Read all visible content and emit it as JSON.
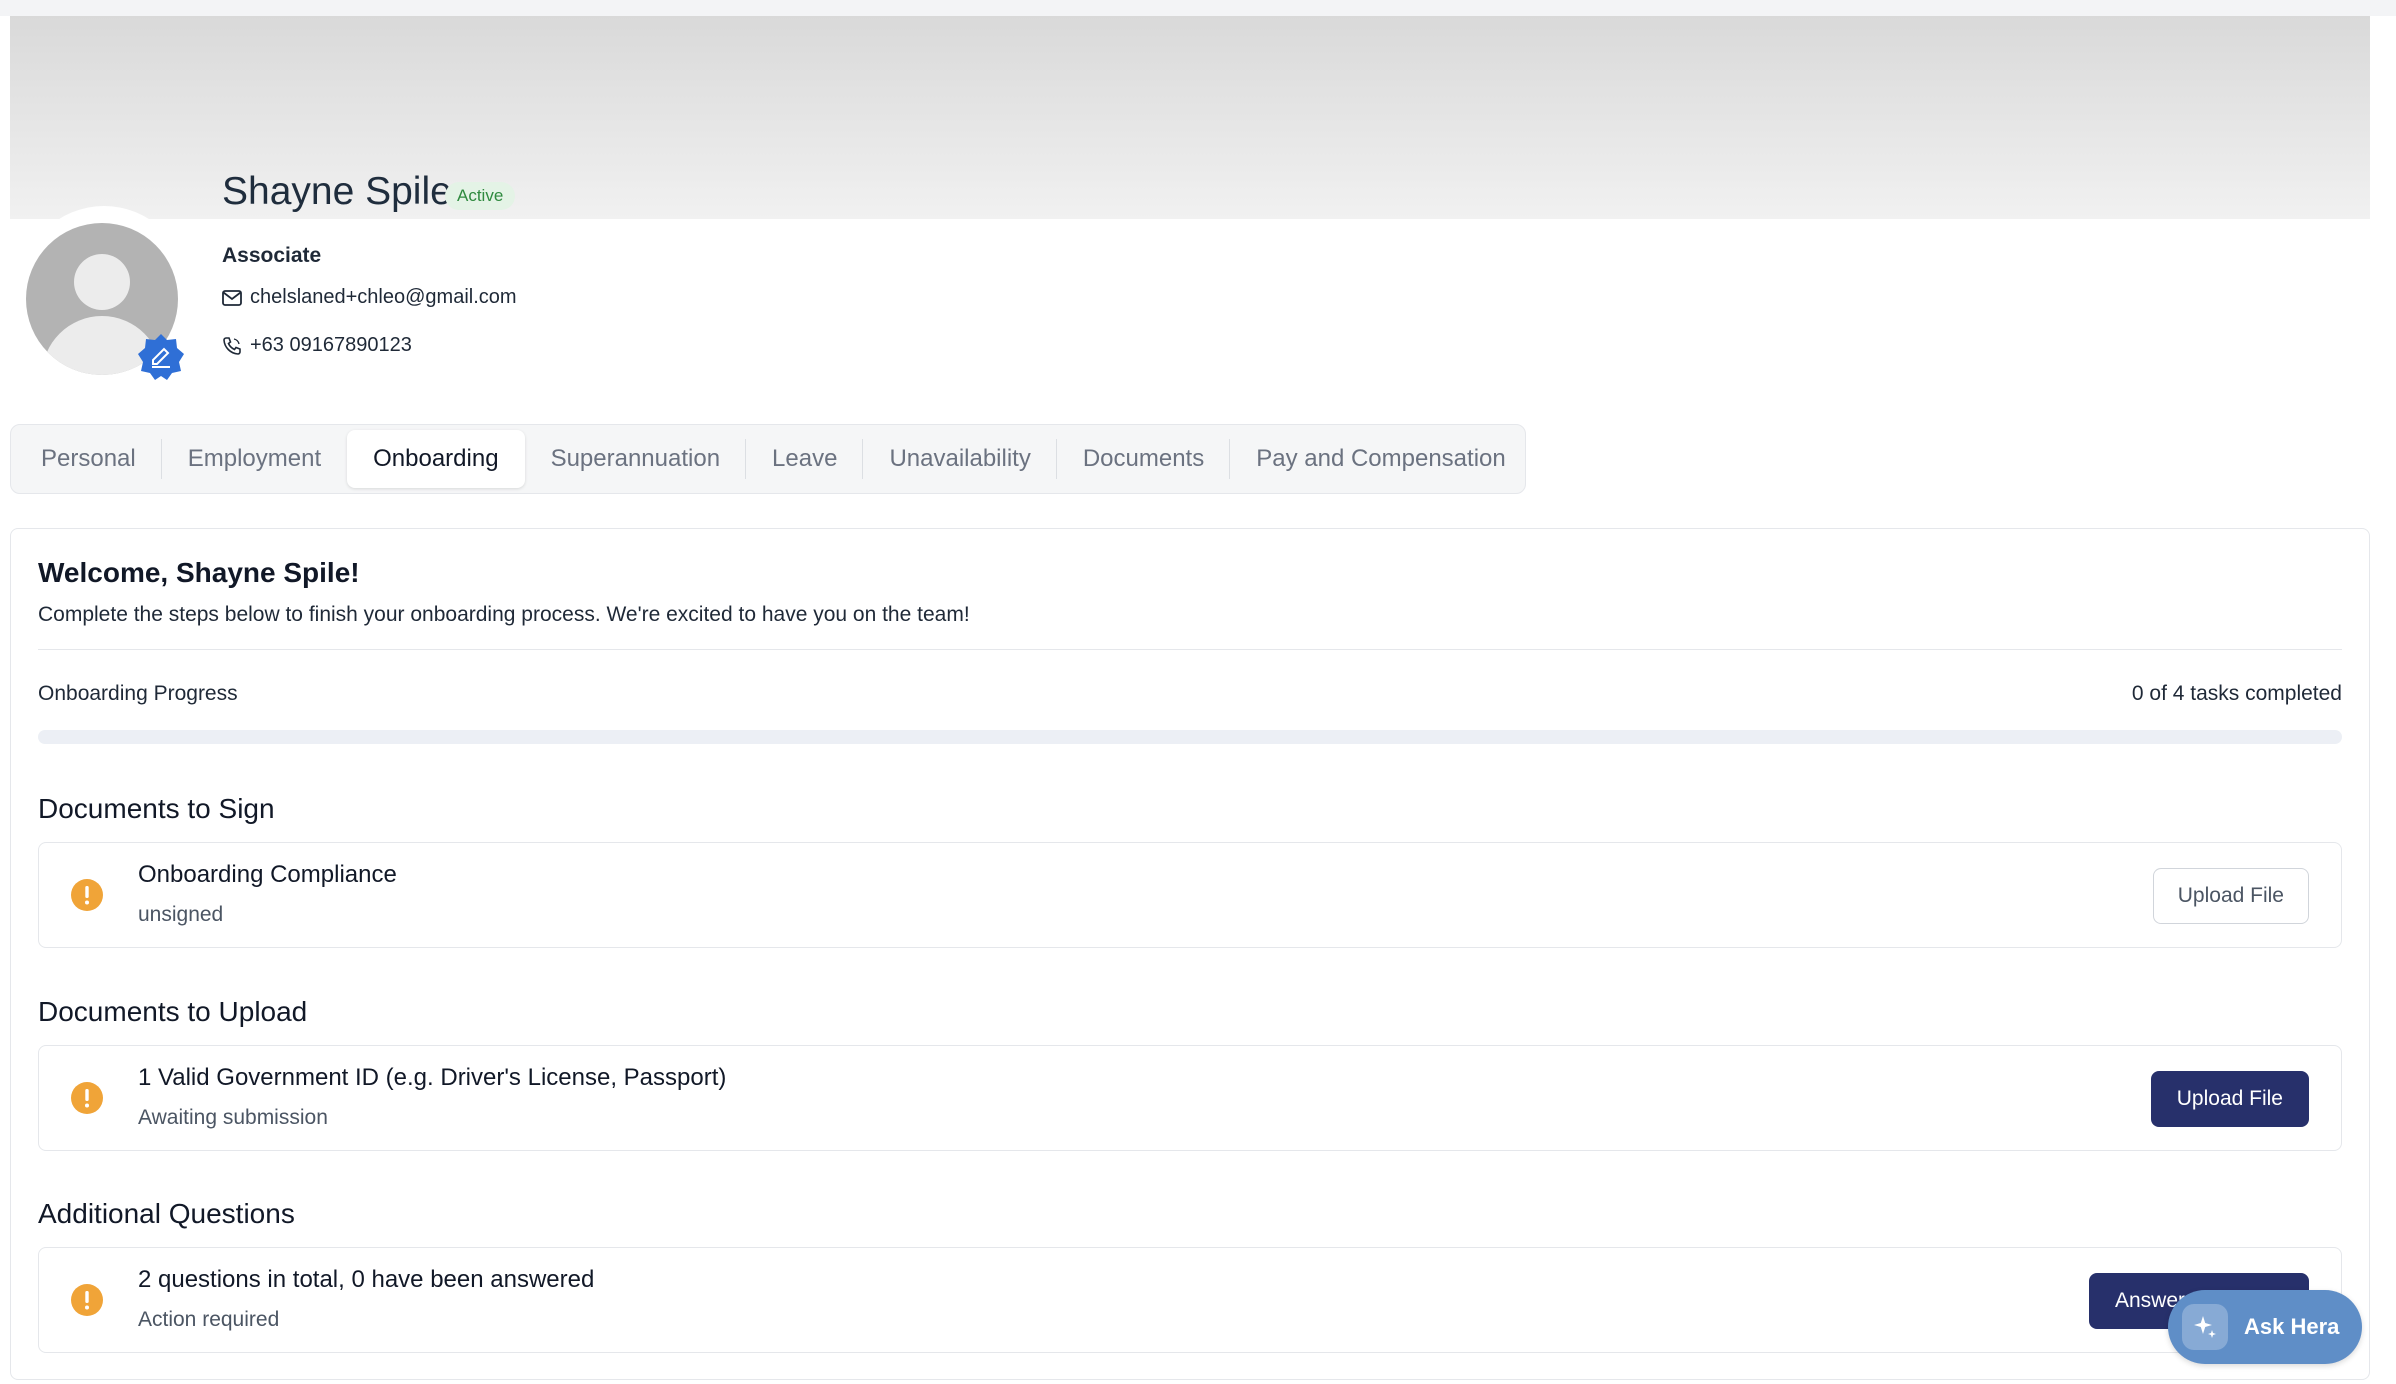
{
  "profile": {
    "name": "Shayne Spile",
    "status": "Active",
    "role": "Associate",
    "email": "chelslaned+chleo@gmail.com",
    "phone": "+63 09167890123"
  },
  "tabs": [
    {
      "label": "Personal"
    },
    {
      "label": "Employment"
    },
    {
      "label": "Onboarding",
      "active": true
    },
    {
      "label": "Superannuation"
    },
    {
      "label": "Leave"
    },
    {
      "label": "Unavailability"
    },
    {
      "label": "Documents"
    },
    {
      "label": "Pay and Compensation"
    }
  ],
  "onboarding": {
    "welcome": "Welcome, Shayne Spile!",
    "subtitle": "Complete the steps below to finish your onboarding process. We're excited to have you on the team!",
    "progress_label": "Onboarding Progress",
    "progress_count": "0 of 4 tasks completed",
    "progress_fraction": 0,
    "sections": [
      {
        "title": "Documents to Sign",
        "items": [
          {
            "title": "Onboarding Compliance",
            "status": "unsigned",
            "button": "Upload File"
          }
        ]
      },
      {
        "title": "Documents to Upload",
        "items": [
          {
            "title": "1 Valid Government ID (e.g. Driver's License, Passport)",
            "status": "Awaiting submission",
            "button": "Upload File"
          }
        ]
      },
      {
        "title": "Additional Questions",
        "items": [
          {
            "title": "2 questions in total, 0 have been answered",
            "status": "Action required",
            "button": "Answer Questions"
          }
        ]
      }
    ]
  },
  "assistant": {
    "label": "Ask Hera"
  },
  "colors": {
    "accent": "#27306b",
    "warning": "#f0a438",
    "active_badge_bg": "#e4f3e6",
    "active_badge_text": "#2f8a3f",
    "assistant": "#5f8ec7",
    "edit_badge": "#2f6fd6"
  }
}
